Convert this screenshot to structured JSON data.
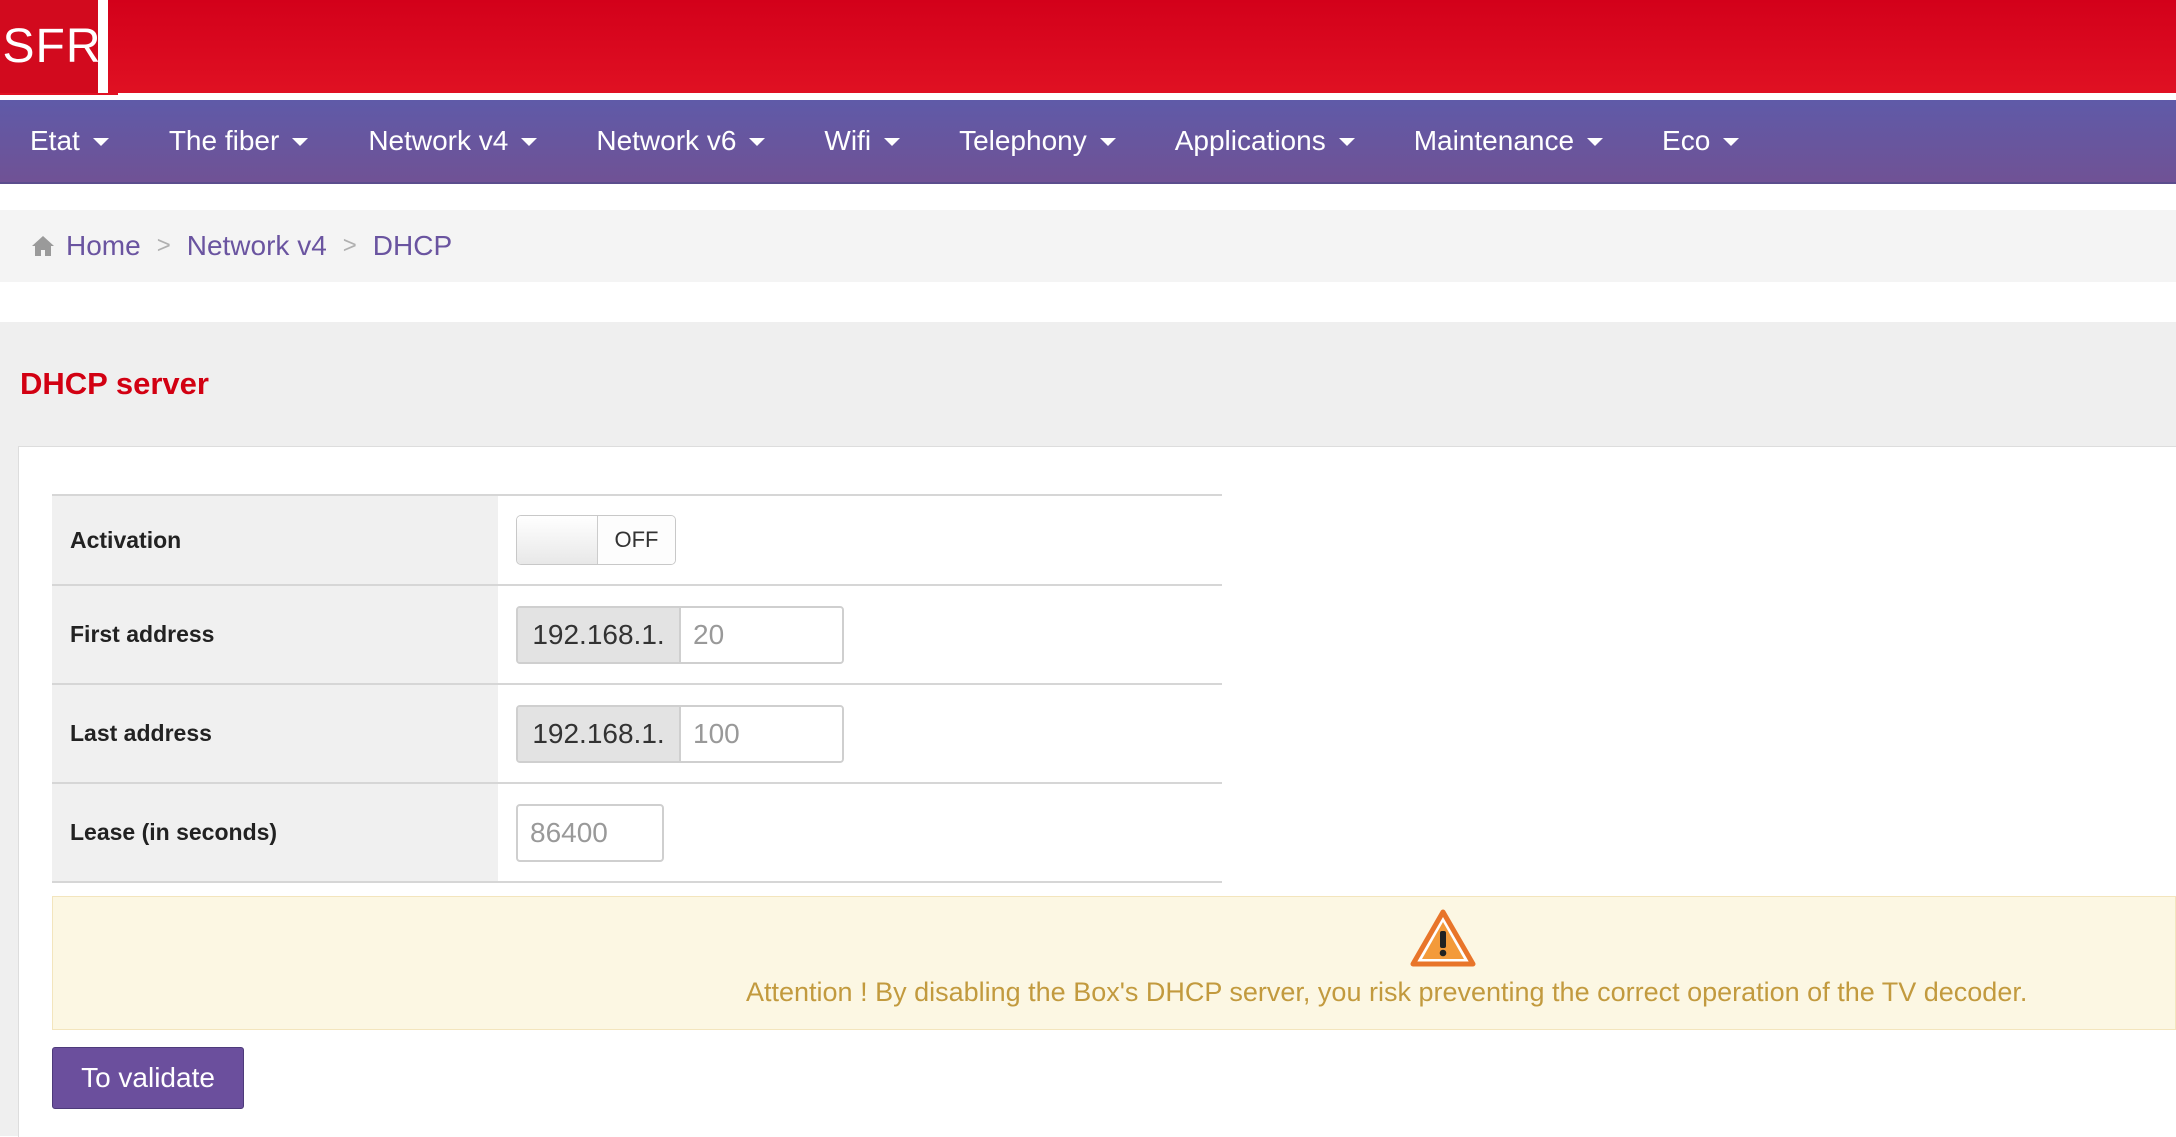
{
  "header": {
    "logo_text": "SFR",
    "brand_color": "#d20a1e"
  },
  "nav": {
    "items": [
      {
        "label": "Etat"
      },
      {
        "label": "The fiber"
      },
      {
        "label": "Network v4"
      },
      {
        "label": "Network v6"
      },
      {
        "label": "Wifi"
      },
      {
        "label": "Telephony"
      },
      {
        "label": "Applications"
      },
      {
        "label": "Maintenance"
      },
      {
        "label": "Eco"
      }
    ],
    "color": "#665aa3"
  },
  "breadcrumb": {
    "home_icon": "home-icon",
    "home": "Home",
    "separator": ">",
    "level1": "Network v4",
    "current": "DHCP"
  },
  "section": {
    "title": "DHCP server",
    "title_color": "#d20012"
  },
  "form": {
    "activation": {
      "label": "Activation",
      "state": "OFF"
    },
    "first_address": {
      "label": "First address",
      "prefix": "192.168.1.",
      "placeholder": "20"
    },
    "last_address": {
      "label": "Last address",
      "prefix": "192.168.1.",
      "placeholder": "100"
    },
    "lease": {
      "label": "Lease (in seconds)",
      "placeholder": "86400"
    }
  },
  "warning": {
    "icon": "warning-icon",
    "text": "Attention ! By disabling the Box's DHCP server, you risk preventing the correct operation of the TV decoder."
  },
  "actions": {
    "validate_label": "To validate",
    "button_color": "#6b4f9d"
  }
}
